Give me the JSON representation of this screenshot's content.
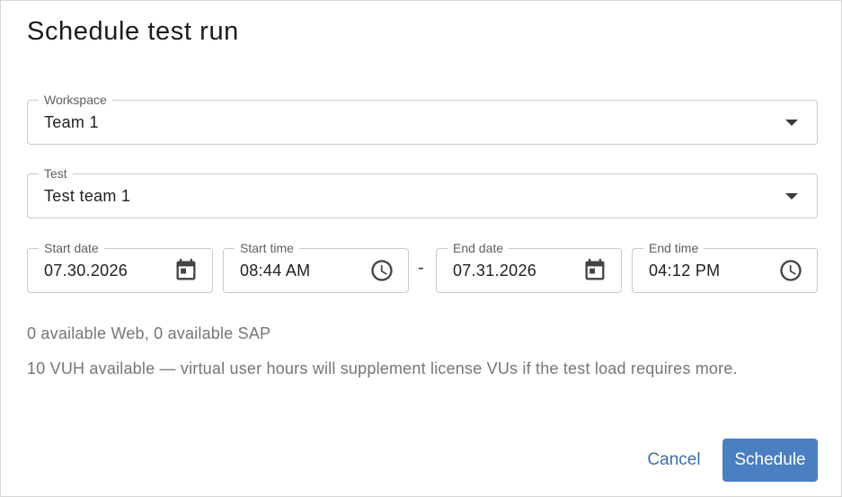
{
  "dialog": {
    "title": "Schedule test run"
  },
  "workspace": {
    "label": "Workspace",
    "value": "Team 1",
    "icon": "chevron-down-icon"
  },
  "test": {
    "label": "Test",
    "value": "Test team 1",
    "icon": "chevron-down-icon"
  },
  "start_date": {
    "label": "Start date",
    "value": "07.30.2026",
    "icon": "calendar-icon"
  },
  "start_time": {
    "label": "Start time",
    "value": "08:44 AM",
    "icon": "clock-icon"
  },
  "separator": "-",
  "end_date": {
    "label": "End date",
    "value": "07.31.2026",
    "icon": "calendar-icon"
  },
  "end_time": {
    "label": "End time",
    "value": "04:12 PM",
    "icon": "clock-icon"
  },
  "availability": "0 available Web, 0 available SAP",
  "vuh_note": "10 VUH available — virtual user hours will supplement license VUs if the test load requires more.",
  "actions": {
    "cancel_label": "Cancel",
    "schedule_label": "Schedule"
  },
  "colors": {
    "primary": "#4a7fc1",
    "link": "#3d6ea8",
    "muted_text": "#767676",
    "border": "#c9c9c9"
  }
}
